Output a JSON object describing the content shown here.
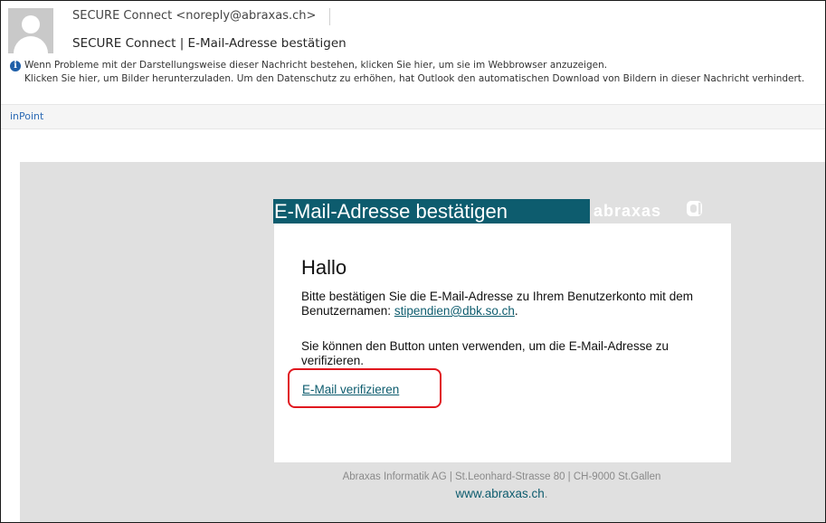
{
  "header": {
    "from": "SECURE Connect <noreply@abraxas.ch>",
    "subject": "SECURE Connect | E-Mail-Adresse bestätigen",
    "info_icon": "info-icon",
    "info_line1": "Wenn Probleme mit der Darstellungsweise dieser Nachricht bestehen, klicken Sie hier, um sie im Webbrowser anzuzeigen.",
    "info_line2": "Klicken Sie hier, um Bilder herunterzuladen. Um den Datenschutz zu erhöhen, hat Outlook den automatischen Download von Bildern in dieser Nachricht verhindert."
  },
  "addin_bar": {
    "label": "inPoint"
  },
  "email": {
    "banner_title": "E-Mail-Adresse bestätigen",
    "logo_text": "abraxas",
    "greeting": "Hallo",
    "paragraph1_text": "Bitte bestätigen Sie die E-Mail-Adresse zu Ihrem Benutzerkonto mit dem Benutzernamen: ",
    "paragraph1_link": "stipendien@dbk.so.ch",
    "paragraph1_end": ".",
    "paragraph2": "Sie können den Button unten verwenden, um die E-Mail-Adresse zu verifizieren.",
    "verify_link": "E-Mail verifizieren",
    "footer_line1": "Abraxas Informatik AG   |   St.Leonhard-Strasse 80   |   CH-9000 St.Gallen",
    "footer_link": "www.abraxas.ch",
    "footer_end": "."
  },
  "colors": {
    "accent": "#0d5c6e",
    "highlight": "#e0181f",
    "canvas": "#e0e0e0"
  }
}
